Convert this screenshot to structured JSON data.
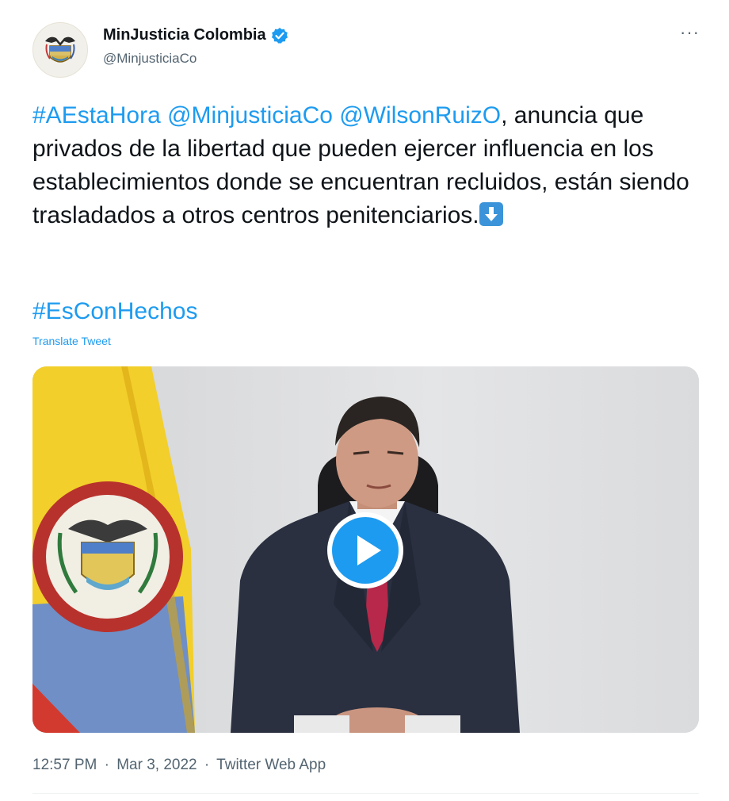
{
  "author": {
    "display_name": "MinJusticia Colombia",
    "handle": "@MinjusticiaCo",
    "verified": true,
    "avatar_icon": "colombia-coat-of-arms-icon"
  },
  "more_label": "···",
  "tweet": {
    "hashtag1": "#AEstaHora",
    "mention1": "@MinjusticiaCo",
    "mention2": "@WilsonRuizO",
    "text": ", anuncia que privados de la libertad que pueden ejercer influencia en los establecimientos donde se encuentran recluidos, están siendo trasladados a otros centros penitenciarios.",
    "emoji": "down-arrow-emoji",
    "hashtag2": "#EsConHechos",
    "translate_label": "Translate Tweet"
  },
  "media": {
    "type": "video",
    "play_icon": "play-icon"
  },
  "meta": {
    "time": "12:57 PM",
    "date": "Mar 3, 2022",
    "source": "Twitter Web App",
    "separator": "·"
  },
  "colors": {
    "link": "#1d9bf0",
    "text": "#0f1419",
    "secondary": "#536471",
    "verified": "#1d9bf0"
  }
}
